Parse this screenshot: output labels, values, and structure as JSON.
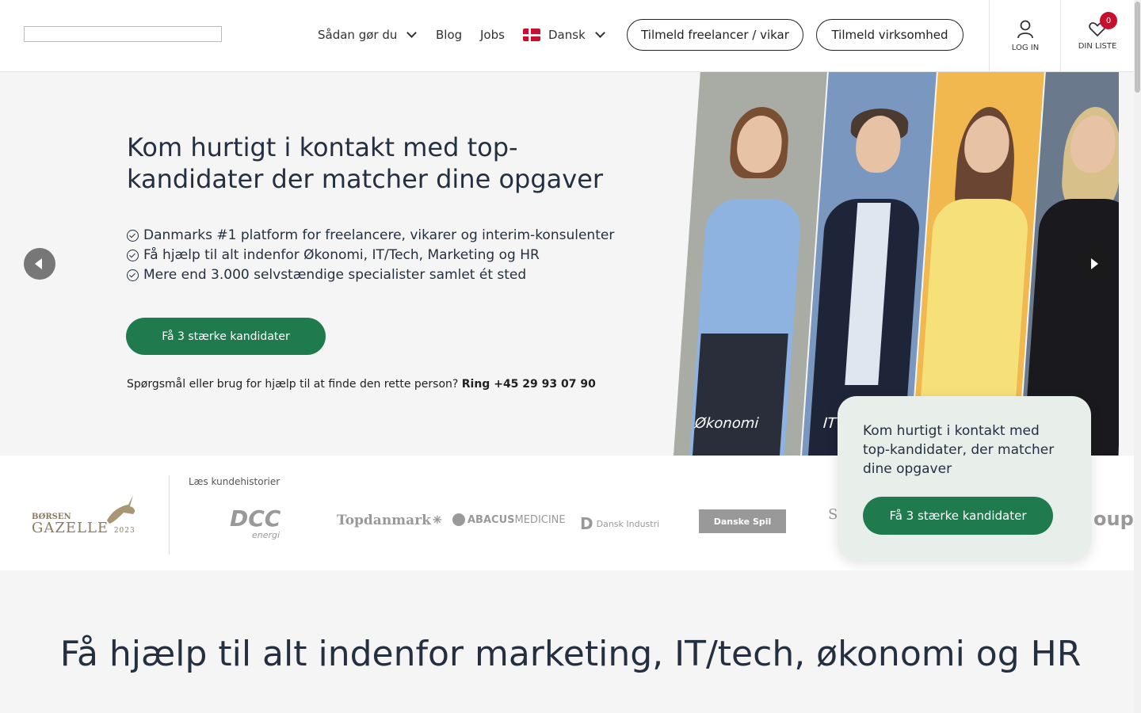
{
  "header": {
    "nav": {
      "how": "Sådan gør du",
      "blog": "Blog",
      "jobs": "Jobs",
      "language": "Dansk"
    },
    "signup_freelancer": "Tilmeld freelancer / vikar",
    "signup_company": "Tilmeld virksomhed",
    "login": "LOG IN",
    "wishlist": "DIN LISTE",
    "wishlist_count": "0"
  },
  "hero": {
    "title": "Kom hurtigt i kontakt med top-kandidater der matcher dine opgaver",
    "bullets": [
      "Danmarks #1 platform for freelancere, vikarer og interim-konsulenter",
      "Få hjælp til alt indenfor Økonomi, IT/Tech, Marketing og HR",
      "Mere end 3.000 selvstændige specialister samlet ét sted"
    ],
    "cta": "Få 3 stærke kandidater",
    "ring_prefix": "Spørgsmål eller brug for hjælp til at finde den rette person?",
    "ring_phone": "Ring +45 29 93 07 90",
    "strip_labels": [
      "Økonomi",
      "IT & T"
    ]
  },
  "logos": {
    "laes": "Læs kundehistorier",
    "gazelle_top": "BØRSEN",
    "gazelle_main": "GAZELLE",
    "gazelle_year": "2023",
    "items": [
      "DCC",
      "energi",
      "Topdanmark",
      "ABACUS",
      "MEDICINE",
      "Dansk Industri",
      "Danske Spil",
      "Sl",
      "oup"
    ]
  },
  "popup": {
    "text": "Kom hurtigt i kontakt med top-kandidater, der matcher dine opgaver",
    "cta": "Få 3 stærke kandidater"
  },
  "section2": {
    "title": "Få hjælp til alt indenfor marketing, IT/tech, økonomi og HR"
  }
}
